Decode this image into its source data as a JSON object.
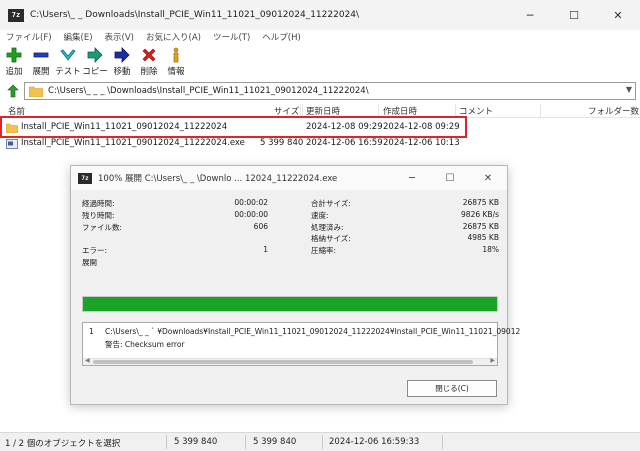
{
  "window": {
    "app_icon_text": "7z",
    "title": "C:\\Users\\_ _ Downloads\\Install_PCIE_Win11_11021_09012024_11222024\\"
  },
  "menu": [
    "ファイル(F)",
    "編集(E)",
    "表示(V)",
    "お気に入り(A)",
    "ツール(T)",
    "ヘルプ(H)"
  ],
  "toolbar": {
    "add": "追加",
    "extract": "展開",
    "test": "テスト",
    "copy": "コピー",
    "move": "移動",
    "delete": "削除",
    "info": "情報"
  },
  "address": {
    "path": "C:\\Users\\_ _ _ \\Downloads\\Install_PCIE_Win11_11021_09012024_11222024\\"
  },
  "columns": {
    "name": "名前",
    "size": "サイズ",
    "modified": "更新日時",
    "created": "作成日時",
    "comment": "コメント",
    "folders": "フォルダー数"
  },
  "files": [
    {
      "name": "Install_PCIE_Win11_11021_09012024_11222024",
      "size": "",
      "modified": "2024-12-08 09:29",
      "created": "2024-12-08 09:29",
      "type": "folder"
    },
    {
      "name": "Install_PCIE_Win11_11021_09012024_11222024.exe",
      "size": "5 399 840",
      "modified": "2024-12-06 16:59",
      "created": "2024-12-06 10:13",
      "type": "exe"
    }
  ],
  "status": {
    "selection": "1 / 2 個のオブジェクトを選択",
    "size1": "5 399 840",
    "size2": "5 399 840",
    "date": "2024-12-06 16:59:33"
  },
  "dialog": {
    "title": "100% 展開 C:\\Users\\_ _ \\Downlo ... 12024_11222024.exe",
    "left_stats": [
      {
        "label": "経過時間:",
        "value": "00:00:02"
      },
      {
        "label": "残り時間:",
        "value": "00:00:00"
      },
      {
        "label": "ファイル数:",
        "value": "606"
      },
      {
        "label": "",
        "value": ""
      },
      {
        "label": "エラー:",
        "value": "1"
      },
      {
        "label": "展開",
        "value": ""
      }
    ],
    "right_stats": [
      {
        "label": "合計サイズ:",
        "value": "26875 KB"
      },
      {
        "label": "速度:",
        "value": "9826 KB/s"
      },
      {
        "label": "処理済み:",
        "value": "26875 KB"
      },
      {
        "label": "格納サイズ:",
        "value": "4985 KB"
      },
      {
        "label": "圧縮率:",
        "value": "18%"
      }
    ],
    "progress": 1.0,
    "messages": {
      "index": "1",
      "path": "C:\\Users\\_ _ ` ¥Downloads¥Install_PCIE_Win11_11021_09012024_11222024¥Install_PCIE_Win11_11021_09012",
      "warning": "警告: Checksum error"
    },
    "close_label": "閉じる(C)"
  },
  "colors": {
    "highlight": "#e0242e",
    "progress": "#1aa324"
  }
}
